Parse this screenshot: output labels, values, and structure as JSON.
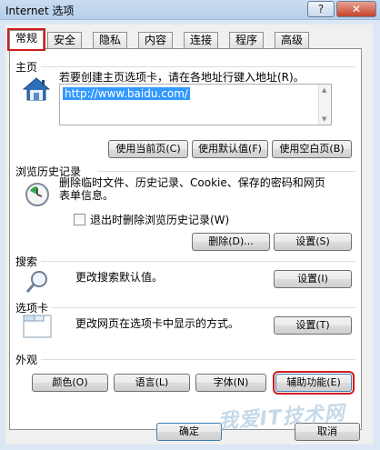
{
  "window": {
    "title": "Internet 选项",
    "help_label": "?",
    "close_label": "✕"
  },
  "tabs": [
    "常规",
    "安全",
    "隐私",
    "内容",
    "连接",
    "程序",
    "高级"
  ],
  "homepage": {
    "title": "主页",
    "description": "若要创建主页选项卡，请在各地址行键入地址(R)。",
    "url": "http://www.baidu.com/",
    "buttons": [
      "使用当前页(C)",
      "使用默认值(F)",
      "使用空白页(B)"
    ]
  },
  "history": {
    "title": "浏览历史记录",
    "description_line1": "删除临时文件、历史记录、Cookie、保存的密码和网页",
    "description_line2": "表单信息。",
    "checkbox_label": "退出时删除浏览历史记录(W)",
    "delete_button": "删除(D)...",
    "settings_button": "设置(S)"
  },
  "search": {
    "title": "搜索",
    "description": "更改搜索默认值。",
    "settings_button": "设置(I)"
  },
  "tabs_section": {
    "title": "选项卡",
    "description": "更改网页在选项卡中显示的方式。",
    "settings_button": "设置(T)"
  },
  "appearance": {
    "title": "外观",
    "buttons": [
      "颜色(O)",
      "语言(L)",
      "字体(N)",
      "辅助功能(E)"
    ]
  },
  "footer": {
    "ok_button": "确定",
    "cancel_button": "取消",
    "watermark": "我爱IT技术网"
  },
  "colors": {
    "highlight_red": "#d21b1b",
    "selection_blue": "#3399ff"
  }
}
